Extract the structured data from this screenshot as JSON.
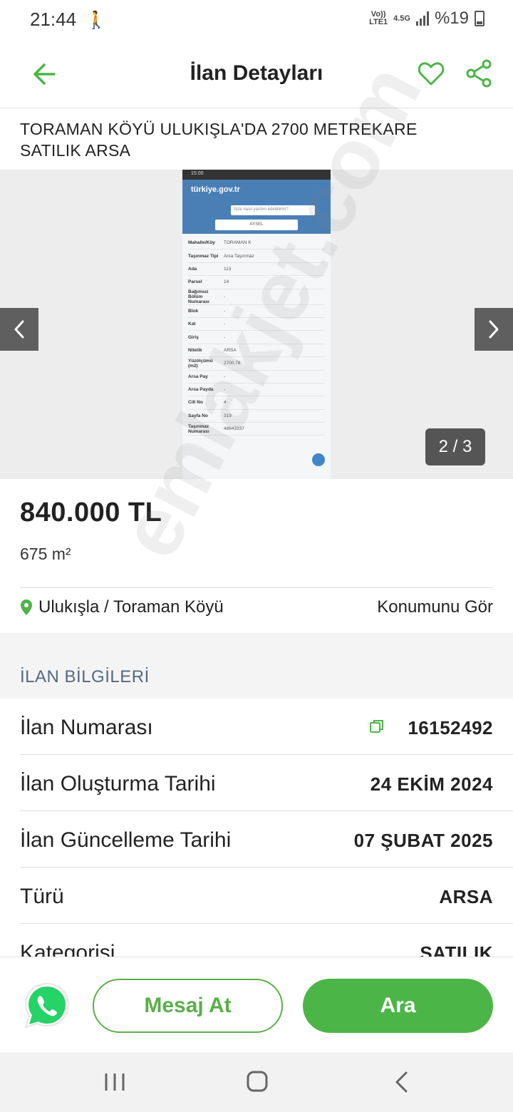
{
  "status_bar": {
    "time": "21:44",
    "volte": "Vo)) LTE1",
    "network": "4.5G",
    "battery": "%19"
  },
  "header": {
    "title": "İlan Detayları",
    "icons": [
      "arrow-left-icon",
      "heart-icon",
      "share-icon"
    ],
    "accent_color": "#4cb548"
  },
  "listing": {
    "title": "TORAMAN KÖYÜ ULUKIŞLA'DA 2700 METREKARE SATILIK ARSA"
  },
  "gallery": {
    "counter": "2 / 3",
    "image": {
      "status_time": "15:00",
      "logo": "türkiye.gov.tr",
      "search_placeholder": "Size nasıl yardım edebilirim?",
      "user": "AYSEL",
      "rows": [
        {
          "key": "Mahalle/Köy",
          "value": "TORAMAN K"
        },
        {
          "key": "Taşınmaz Tipi",
          "value": "Arsa Taşınmaz"
        },
        {
          "key": "Ada",
          "value": "113"
        },
        {
          "key": "Parsel",
          "value": "14"
        },
        {
          "key": "Bağımsız Bölüm Numarası",
          "value": "-"
        },
        {
          "key": "Blok",
          "value": "-"
        },
        {
          "key": "Kat",
          "value": "-"
        },
        {
          "key": "Giriş",
          "value": "-"
        },
        {
          "key": "Nitelik",
          "value": "ARSA"
        },
        {
          "key": "Yüzölçümü (m2)",
          "value": "2700.78"
        },
        {
          "key": "Arsa Pay",
          "value": "-"
        },
        {
          "key": "Arsa Payda",
          "value": "-"
        },
        {
          "key": "Cilt No",
          "value": "4"
        },
        {
          "key": "Sayfa No",
          "value": "319"
        },
        {
          "key": "Taşınmaz Numarası",
          "value": "48643337"
        }
      ]
    }
  },
  "price_card": {
    "price": "840.000 TL",
    "area": "675 m²",
    "location": "Ulukışla / Toraman Köyü",
    "map_link": "Konumunu Gör"
  },
  "info": {
    "header": "İLAN BİLGİLERİ",
    "rows": [
      {
        "label": "İlan Numarası",
        "value": "16152492"
      },
      {
        "label": "İlan Oluşturma Tarihi",
        "value": "24 EKİM 2024"
      },
      {
        "label": "İlan Güncelleme Tarihi",
        "value": "07 ŞUBAT 2025"
      },
      {
        "label": "Türü",
        "value": "ARSA"
      },
      {
        "label": "Kategorisi",
        "value": "SATILIK"
      }
    ]
  },
  "watermark": "emlakjet.com",
  "actions": {
    "message": "Mesaj At",
    "call": "Ara",
    "whatsapp_color": "#25d366"
  }
}
